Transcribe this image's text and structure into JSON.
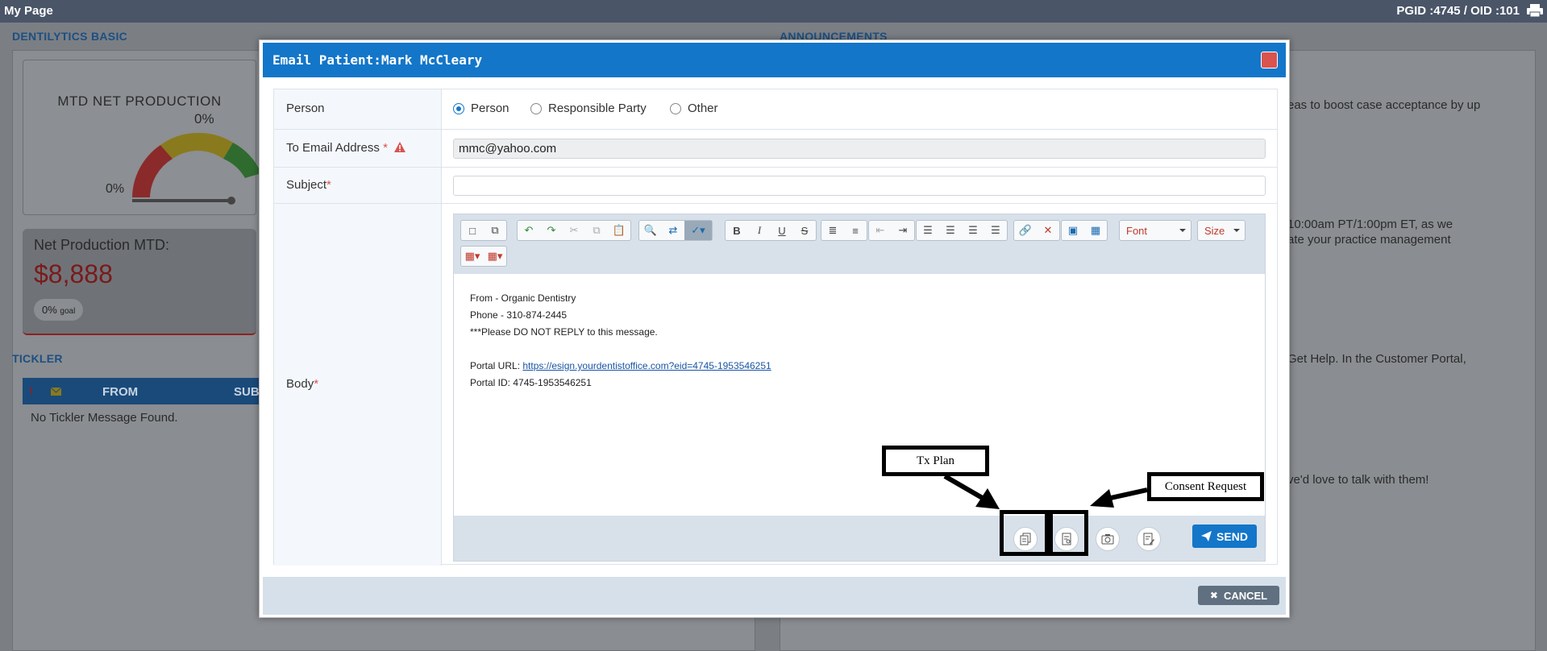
{
  "topbar": {
    "title": "My Page",
    "ids": "PGID :4745  /  OID :101"
  },
  "background": {
    "dentilytics_title": "DENTILYTICS BASIC",
    "mtd_label": "MTD NET PRODUCTION",
    "mtd_pct_top": "0%",
    "mtd_pct_left": "0%",
    "net_prod_label": "Net Production MTD:",
    "net_prod_amount": "$8,888",
    "goal_pct": "0%",
    "goal_word": "goal",
    "tickler_title": "TICKLER",
    "tickler_col_alert": "!",
    "tickler_col_from": "FROM",
    "tickler_col_sub": "SUB",
    "tickler_empty": "No Tickler Message Found.",
    "announcements_title": "ANNOUNCEMENTS",
    "ann_lines": [
      "eas to boost case acceptance by up",
      "10:00am PT/1:00pm ET, as we",
      "ate your practice management",
      " Get Help. In the Customer Portal,",
      "ve'd love to talk with them!"
    ]
  },
  "modal": {
    "title": "Email Patient:Mark McCleary",
    "labels": {
      "person": "Person",
      "to_email": "To Email Address",
      "subject": "Subject",
      "body": "Body",
      "required_mark": "*"
    },
    "radios": [
      {
        "label": "Person",
        "checked": true
      },
      {
        "label": "Responsible Party",
        "checked": false
      },
      {
        "label": "Other",
        "checked": false
      }
    ],
    "to_email_value": "mmc@yahoo.com",
    "subject_value": "",
    "toolbar": {
      "font_label": "Font",
      "size_label": "Size"
    },
    "body": {
      "from_line": "From - Organic Dentistry",
      "phone_line": "Phone - 310-874-2445",
      "noreply_line": "***Please DO NOT REPLY to this message.",
      "portal_url_label": "Portal URL: ",
      "portal_url": "https://esign.yourdentistoffice.com?eid=4745-1953546251",
      "portal_id_line": "Portal ID: 4745-1953546251"
    },
    "send_label": "SEND",
    "cancel_label": "CANCEL"
  },
  "annotations": {
    "tx_plan": "Tx Plan",
    "consent_request": "Consent Request"
  },
  "colors": {
    "header_blue": "#1376c9",
    "close_red": "#d9534f",
    "required_red": "#d9534f",
    "cancel_gray": "#607080"
  }
}
